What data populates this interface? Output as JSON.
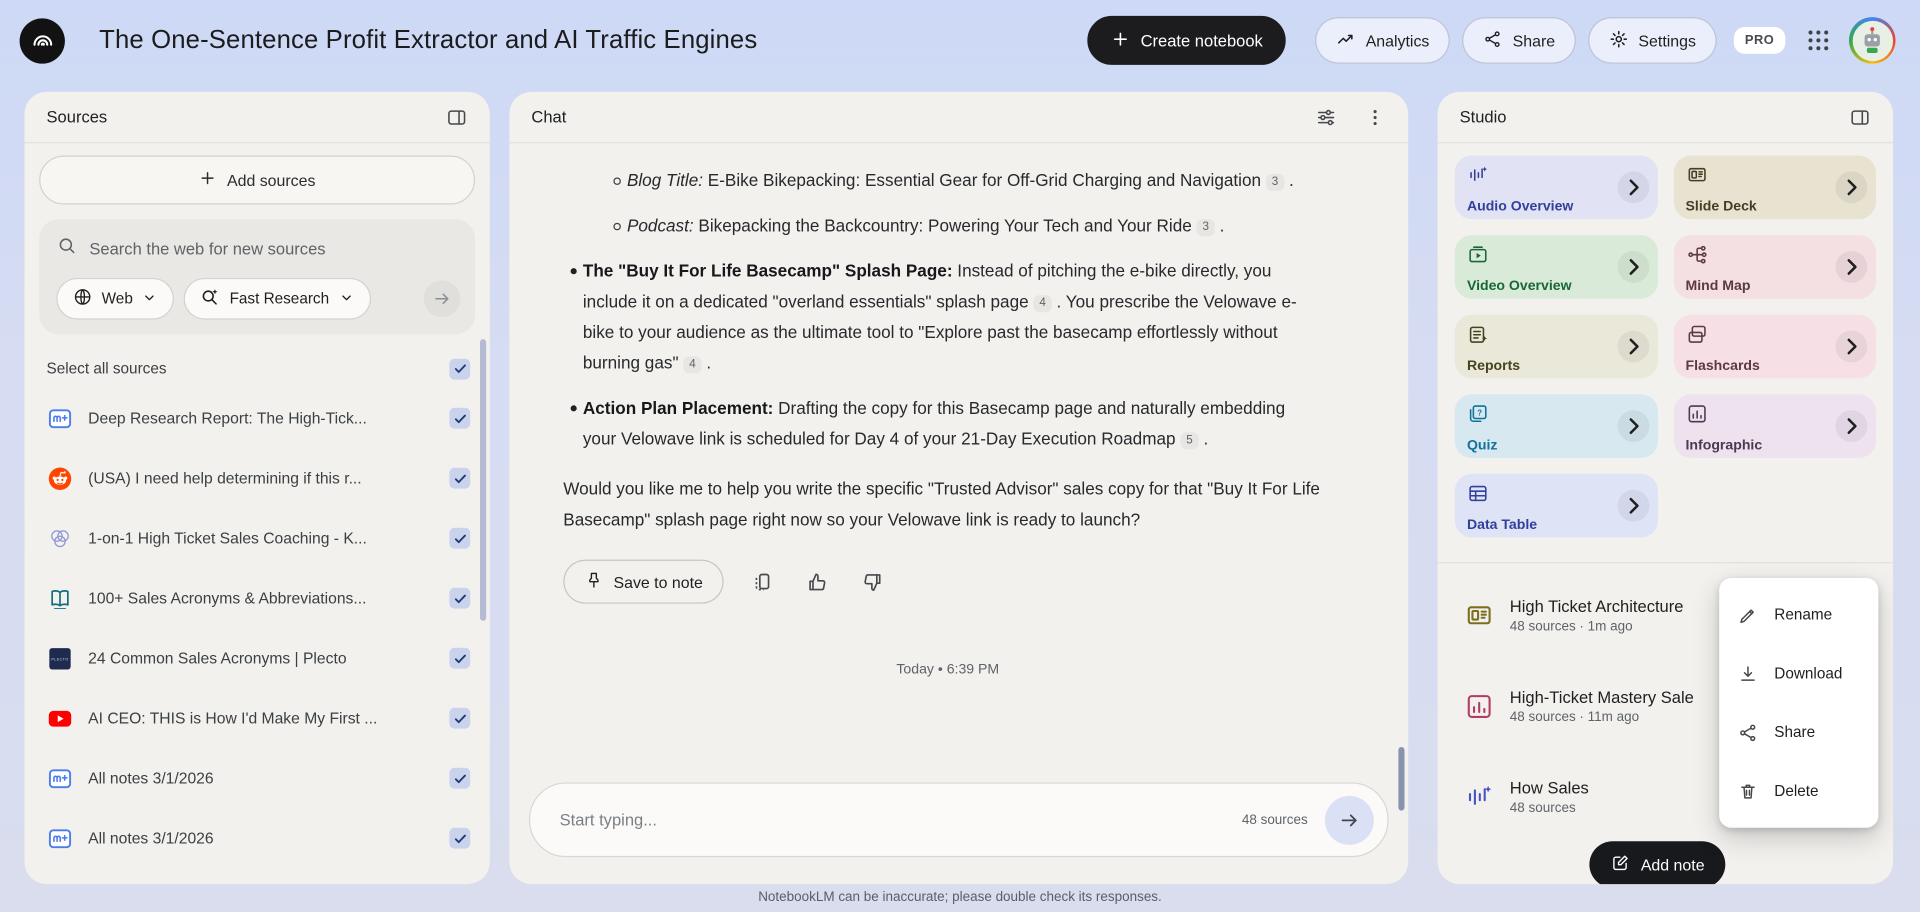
{
  "header": {
    "title": "The One-Sentence Profit Extractor and AI Traffic Engines",
    "create_notebook_label": "Create notebook",
    "analytics_label": "Analytics",
    "share_label": "Share",
    "settings_label": "Settings",
    "pro_badge": "PRO"
  },
  "sources": {
    "panel_title": "Sources",
    "add_sources_label": "Add sources",
    "search_placeholder": "Search the web for new sources",
    "web_filter_label": "Web",
    "research_mode_label": "Fast Research",
    "select_all_label": "Select all sources",
    "items": [
      {
        "title": "Deep Research Report: The High-Tick...",
        "icon": "notebook-doc",
        "checked": true
      },
      {
        "title": "(USA) I need help determining if this r...",
        "icon": "reddit",
        "checked": true
      },
      {
        "title": "1-on-1 High Ticket Sales Coaching - K...",
        "icon": "venn",
        "checked": true
      },
      {
        "title": "100+ Sales Acronyms & Abbreviations...",
        "icon": "book",
        "checked": true
      },
      {
        "title": "24 Common Sales Acronyms | Plecto",
        "icon": "plecto",
        "checked": true
      },
      {
        "title": "AI CEO: THIS is How I'd Make My First ...",
        "icon": "youtube",
        "checked": true
      },
      {
        "title": "All notes 3/1/2026",
        "icon": "notebook-doc",
        "checked": true
      },
      {
        "title": "All notes 3/1/2026",
        "icon": "notebook-doc",
        "checked": true
      }
    ]
  },
  "chat": {
    "panel_title": "Chat",
    "bullets": [
      {
        "level": 2,
        "segments": [
          {
            "i": "Blog Title:"
          },
          {
            "t": " E-Bike Bikepacking: Essential Gear for Off-Grid Charging and Navigation "
          },
          {
            "c": "3"
          },
          {
            "t": " ."
          }
        ]
      },
      {
        "level": 2,
        "segments": [
          {
            "i": "Podcast:"
          },
          {
            "t": " Bikepacking the Backcountry: Powering Your Tech and Your Ride "
          },
          {
            "c": "3"
          },
          {
            "t": " ."
          }
        ]
      },
      {
        "level": 1,
        "segments": [
          {
            "b": "The \"Buy It For Life Basecamp\" Splash Page:"
          },
          {
            "t": " Instead of pitching the e-bike directly, you include it on a dedicated \"overland essentials\" splash page "
          },
          {
            "c": "4"
          },
          {
            "t": " . You prescribe the Velowave e-bike to your audience as the ultimate tool to \"Explore past the basecamp effortlessly without burning gas\" "
          },
          {
            "c": "4"
          },
          {
            "t": " ."
          }
        ]
      },
      {
        "level": 1,
        "segments": [
          {
            "b": "Action Plan Placement:"
          },
          {
            "t": " Drafting the copy for this Basecamp page and naturally embedding your Velowave link is scheduled for Day 4 of your 21-Day Execution Roadmap "
          },
          {
            "c": "5"
          },
          {
            "t": " ."
          }
        ]
      }
    ],
    "closing_paragraph": "Would you like me to help you write the specific \"Trusted Advisor\" sales copy for that \"Buy It For Life Basecamp\" splash page right now so your Velowave link is ready to launch?",
    "save_to_note_label": "Save to note",
    "timestamp": "Today • 6:39 PM",
    "input_placeholder": "Start typing...",
    "source_count_label": "48 sources",
    "disclaimer": "NotebookLM can be inaccurate; please double check its responses."
  },
  "studio": {
    "panel_title": "Studio",
    "tiles": [
      {
        "label": "Audio Overview",
        "icon": "audio",
        "bg": "#e1e3f5",
        "fg": "#31409b"
      },
      {
        "label": "Slide Deck",
        "icon": "slide",
        "bg": "#e8e2d0",
        "fg": "#433f25"
      },
      {
        "label": "Video Overview",
        "icon": "video",
        "bg": "#d9ebd8",
        "fg": "#18663a"
      },
      {
        "label": "Mind Map",
        "icon": "mindmap",
        "bg": "#f4dfe2",
        "fg": "#5c3a40"
      },
      {
        "label": "Reports",
        "icon": "reports",
        "bg": "#eae8d8",
        "fg": "#45441f"
      },
      {
        "label": "Flashcards",
        "icon": "flashcards",
        "bg": "#f6e0e5",
        "fg": "#5c3a45"
      },
      {
        "label": "Quiz",
        "icon": "quiz",
        "bg": "#d7e8f0",
        "fg": "#11729e"
      },
      {
        "label": "Infographic",
        "icon": "infographic",
        "bg": "#ede2ee",
        "fg": "#4c3a52"
      },
      {
        "label": "Data Table",
        "icon": "datatable",
        "bg": "#dee3f5",
        "fg": "#31409b"
      }
    ],
    "artifacts": [
      {
        "title": "High Ticket Architecture",
        "meta": "48 sources · 1m ago",
        "icon": "slide",
        "color": "#7d6e1f",
        "actions": false
      },
      {
        "title": "High-Ticket Mastery Sale",
        "meta": "48 sources · 11m ago",
        "icon": "infographic",
        "color": "#b33b66",
        "actions": false
      },
      {
        "title": "How Sales",
        "meta": "48 sources",
        "icon": "audio",
        "color": "#4353c4",
        "actions": true
      }
    ],
    "add_note_label": "Add note",
    "context_menu": [
      {
        "label": "Rename",
        "icon": "pencil"
      },
      {
        "label": "Download",
        "icon": "download"
      },
      {
        "label": "Share",
        "icon": "share"
      },
      {
        "label": "Delete",
        "icon": "trash"
      }
    ]
  }
}
